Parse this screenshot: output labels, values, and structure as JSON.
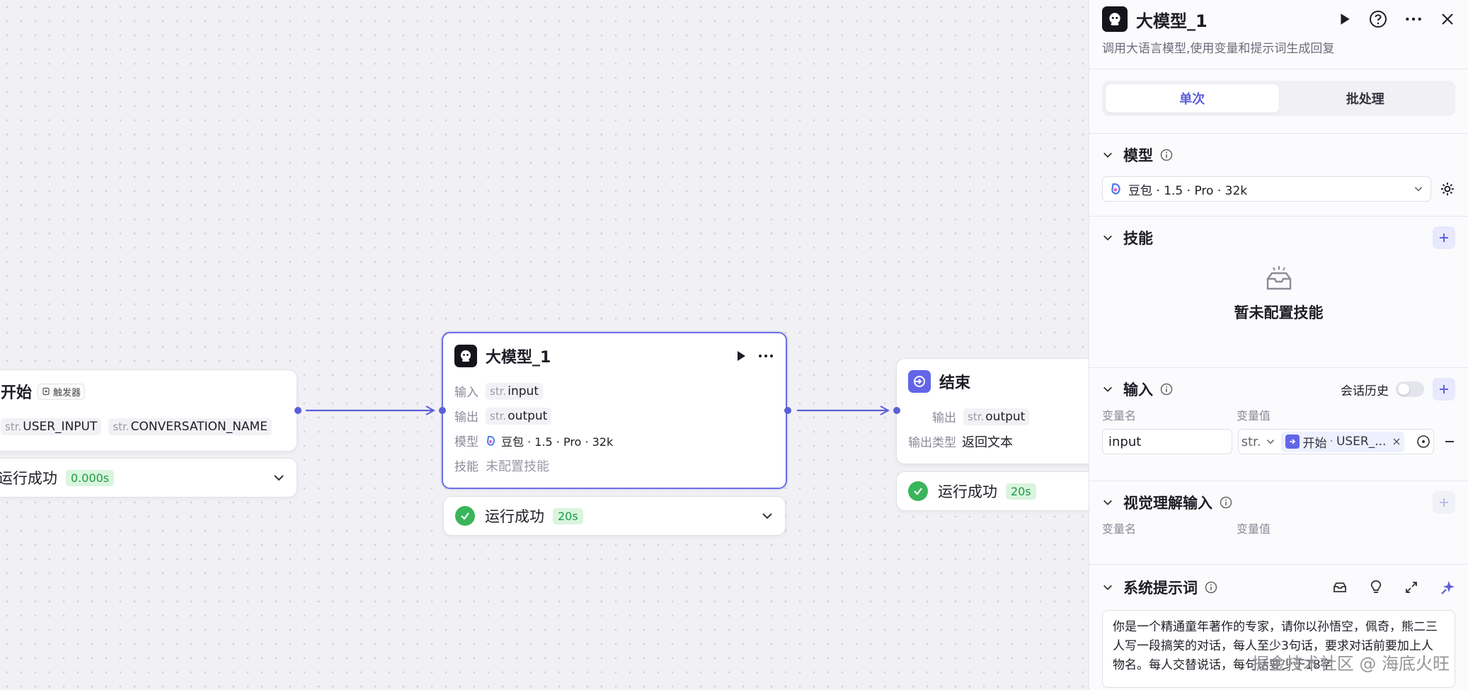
{
  "canvas": {
    "start_node": {
      "title": "开始",
      "badge": "触发器",
      "outputs": [
        {
          "type": "str.",
          "name": "USER_INPUT"
        },
        {
          "type": "str.",
          "name": "CONVERSATION_NAME"
        }
      ],
      "status": "运行成功",
      "duration": "0.000s"
    },
    "llm_node": {
      "title": "大模型_1",
      "input_label": "输入",
      "input_type": "str.",
      "input_name": "input",
      "output_label": "输出",
      "output_type": "str.",
      "output_name": "output",
      "model_label": "模型",
      "model_value": "豆包 · 1.5 · Pro · 32k",
      "skill_label": "技能",
      "skill_value": "未配置技能",
      "status": "运行成功",
      "duration": "20s"
    },
    "end_node": {
      "title": "结束",
      "output_label": "输出",
      "output_type": "str.",
      "output_name": "output",
      "output_type_label": "输出类型",
      "output_type_value": "返回文本",
      "status": "运行成功",
      "duration": "20s"
    }
  },
  "panel": {
    "title": "大模型_1",
    "description": "调用大语言模型,使用变量和提示词生成回复",
    "tabs": [
      "单次",
      "批处理"
    ],
    "model_section": {
      "title": "模型",
      "selected": "豆包 · 1.5 · Pro · 32k"
    },
    "skill_section": {
      "title": "技能",
      "empty": "暂未配置技能"
    },
    "input_section": {
      "title": "输入",
      "history_label": "会话历史",
      "col_name": "变量名",
      "col_value": "变量值",
      "var_name": "input",
      "var_type": "str.",
      "ref_node": "开始",
      "ref_var": "USER_..."
    },
    "vision_section": {
      "title": "视觉理解输入",
      "col_name": "变量名",
      "col_value": "变量值"
    },
    "system_prompt": {
      "title": "系统提示词",
      "text": "你是一个精通童年著作的专家，请你以孙悟空，佩奇，熊二三人写一段搞笑的对话，每人至少3句话，要求对话前要加上人物名。每人交替说话，每句话要少于18字"
    },
    "watermark": "掘金技术社区 @ 海底火旺"
  },
  "colors": {
    "accent": "#5b5fdc",
    "success": "#3ab55a",
    "edge": "#5a5fd8"
  }
}
